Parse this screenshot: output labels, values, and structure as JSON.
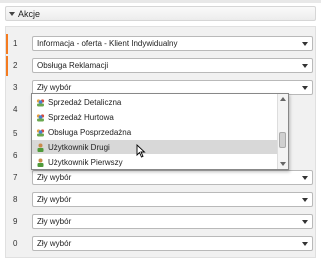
{
  "section": {
    "title": "Akcje"
  },
  "rows": [
    {
      "num": "1",
      "value": "Informacja - oferta - Klient Indywidualny"
    },
    {
      "num": "2",
      "value": "Obsługa Reklamacji"
    },
    {
      "num": "3",
      "value": "Zły wybór"
    },
    {
      "num": "4",
      "value": ""
    },
    {
      "num": "5",
      "value": ""
    },
    {
      "num": "6",
      "value": ""
    },
    {
      "num": "7",
      "value": "Zły wybór"
    },
    {
      "num": "8",
      "value": "Zły wybór"
    },
    {
      "num": "9",
      "value": "Zły wybór"
    },
    {
      "num": "0",
      "value": "Zły wybór"
    }
  ],
  "dropdown": {
    "items": [
      {
        "label": "Sprzedaż Detaliczna",
        "icon": "people-group-icon"
      },
      {
        "label": "Sprzedaż Hurtowa",
        "icon": "people-group-icon"
      },
      {
        "label": "Obsługa Posprzedażna",
        "icon": "people-group-icon"
      },
      {
        "label": "Użytkownik  Drugi",
        "icon": "user-icon",
        "highlighted": true
      },
      {
        "label": "Użytkownik Pierwszy",
        "icon": "user-icon"
      }
    ]
  },
  "colors": {
    "accent": "#f47b20",
    "highlight": "#d8d8d8"
  }
}
